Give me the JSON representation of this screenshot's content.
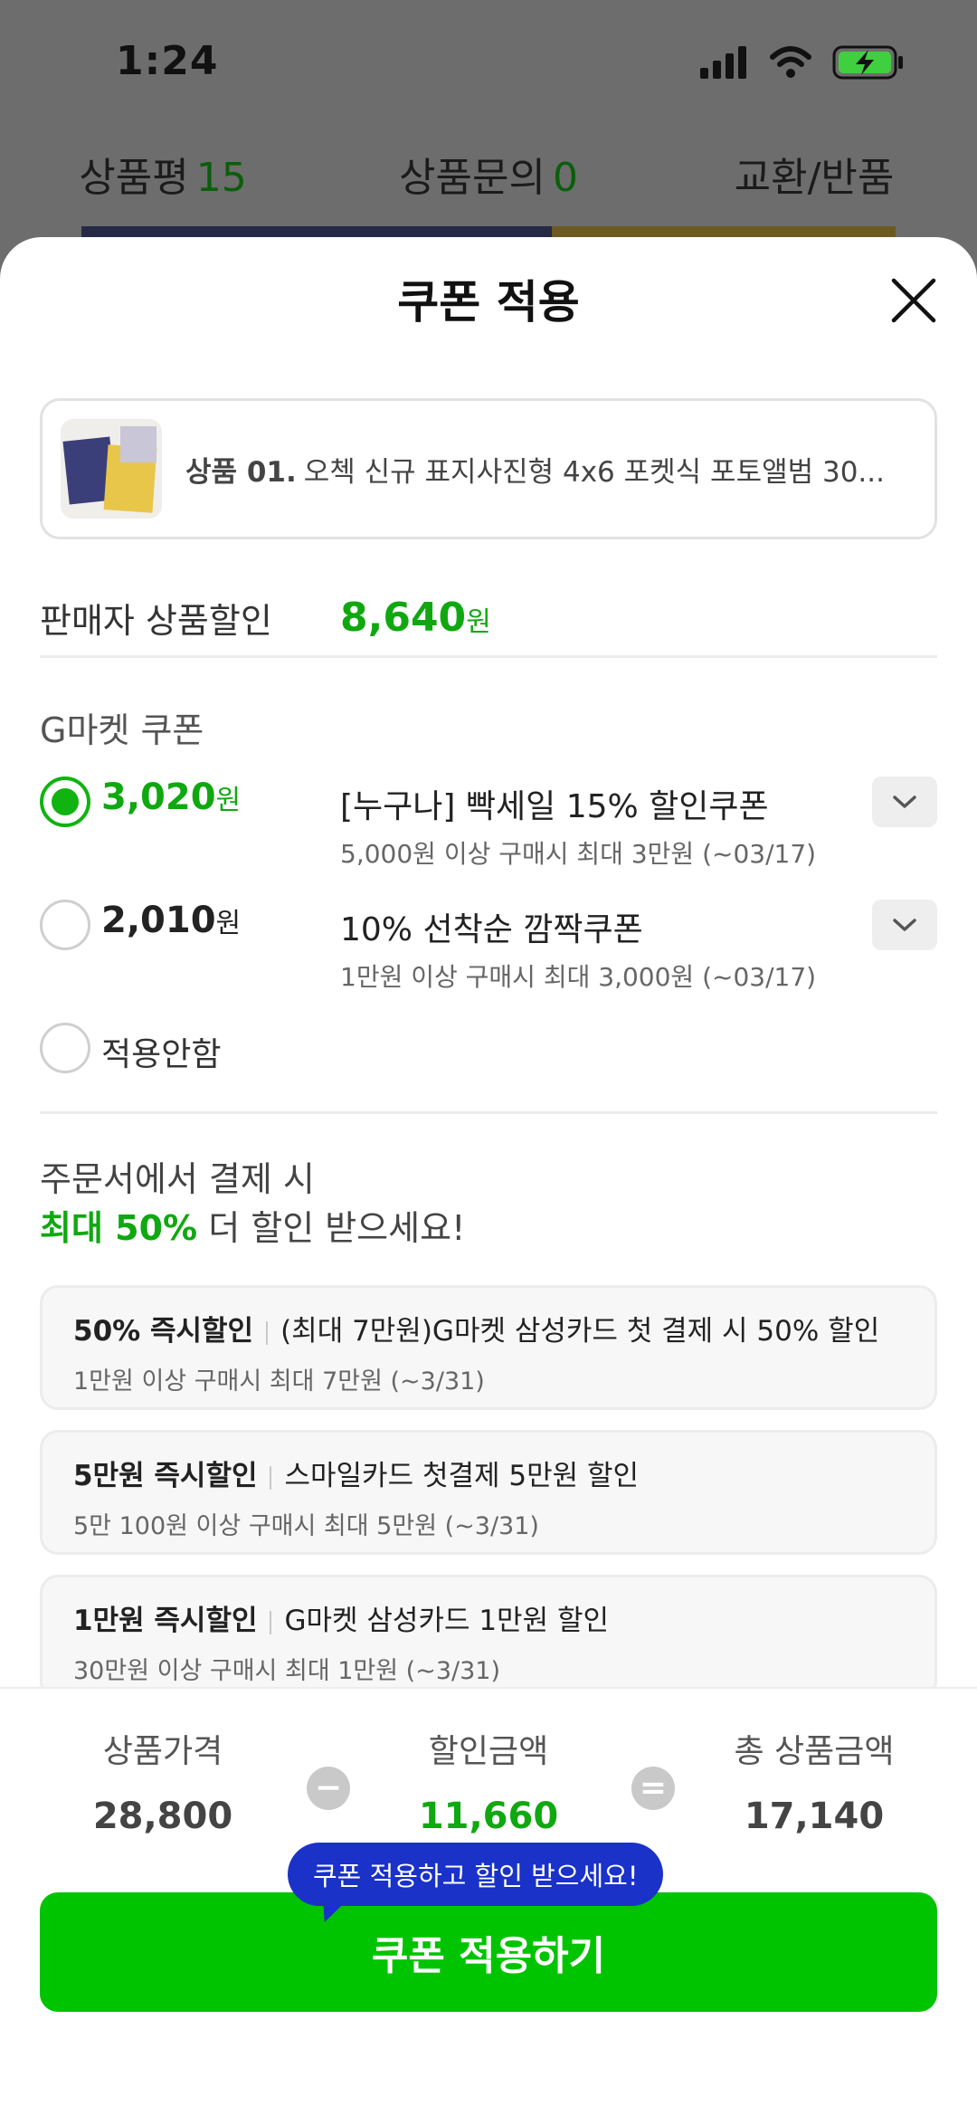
{
  "status_bar": {
    "time": "1:24"
  },
  "background_tabs": [
    {
      "label": "상품평",
      "count": "15"
    },
    {
      "label": "상품문의",
      "count": "0"
    },
    {
      "label": "교환/반품",
      "count": ""
    }
  ],
  "sheet": {
    "title": "쿠폰 적용",
    "product": {
      "prefix": "상품 01.",
      "name": "오첵 신규 표지사진형 4x6 포켓식 포토앨범 30..."
    },
    "seller_discount": {
      "label": "판매자 상품할인",
      "amount": "8,640",
      "unit": "원"
    },
    "gmarket_coupons": {
      "title": "G마켓 쿠폰",
      "options": [
        {
          "amount": "3,020",
          "unit": "원",
          "name": "[누구나] 빡세일 15% 할인쿠폰",
          "condition": "5,000원 이상 구매시 최대 3만원 (~03/17)",
          "selected": true
        },
        {
          "amount": "2,010",
          "unit": "원",
          "name": "10% 선착순 깜짝쿠폰",
          "condition": "1만원 이상 구매시 최대 3,000원 (~03/17)",
          "selected": false
        }
      ],
      "none_label": "적용안함"
    },
    "promo": {
      "line1": "주문서에서 결제 시",
      "highlight": "최대 50%",
      "line2_rest": " 더 할인 받으세요!",
      "cards": [
        {
          "title": "50% 즉시할인",
          "desc": "(최대 7만원)G마켓 삼성카드 첫 결제 시 50% 할인",
          "condition": "1만원 이상 구매시 최대 7만원 (~3/31)"
        },
        {
          "title": "5만원 즉시할인",
          "desc": "스마일카드 첫결제 5만원 할인",
          "condition": "5만 100원 이상 구매시 최대 5만원 (~3/31)"
        },
        {
          "title": "1만원 즉시할인",
          "desc": "G마켓 삼성카드 1만원 할인",
          "condition": "30만원 이상 구매시 최대 1만원 (~3/31)"
        }
      ]
    },
    "summary": {
      "price_label": "상품가격",
      "price": "28,800",
      "minus": "−",
      "discount_label": "할인금액",
      "discount": "11,660",
      "equals": "=",
      "total_label": "총 상품금액",
      "total": "17,140"
    },
    "tooltip": "쿠폰 적용하고 할인 받으세요!",
    "cta": "쿠폰 적용하기"
  },
  "colors": {
    "accent_green": "#10a810",
    "button_green": "#00c400",
    "tooltip_blue": "#1a32c8"
  },
  "icons": [
    "signal-icon",
    "wifi-icon",
    "battery-charging-icon",
    "close-icon",
    "chevron-down-icon"
  ]
}
